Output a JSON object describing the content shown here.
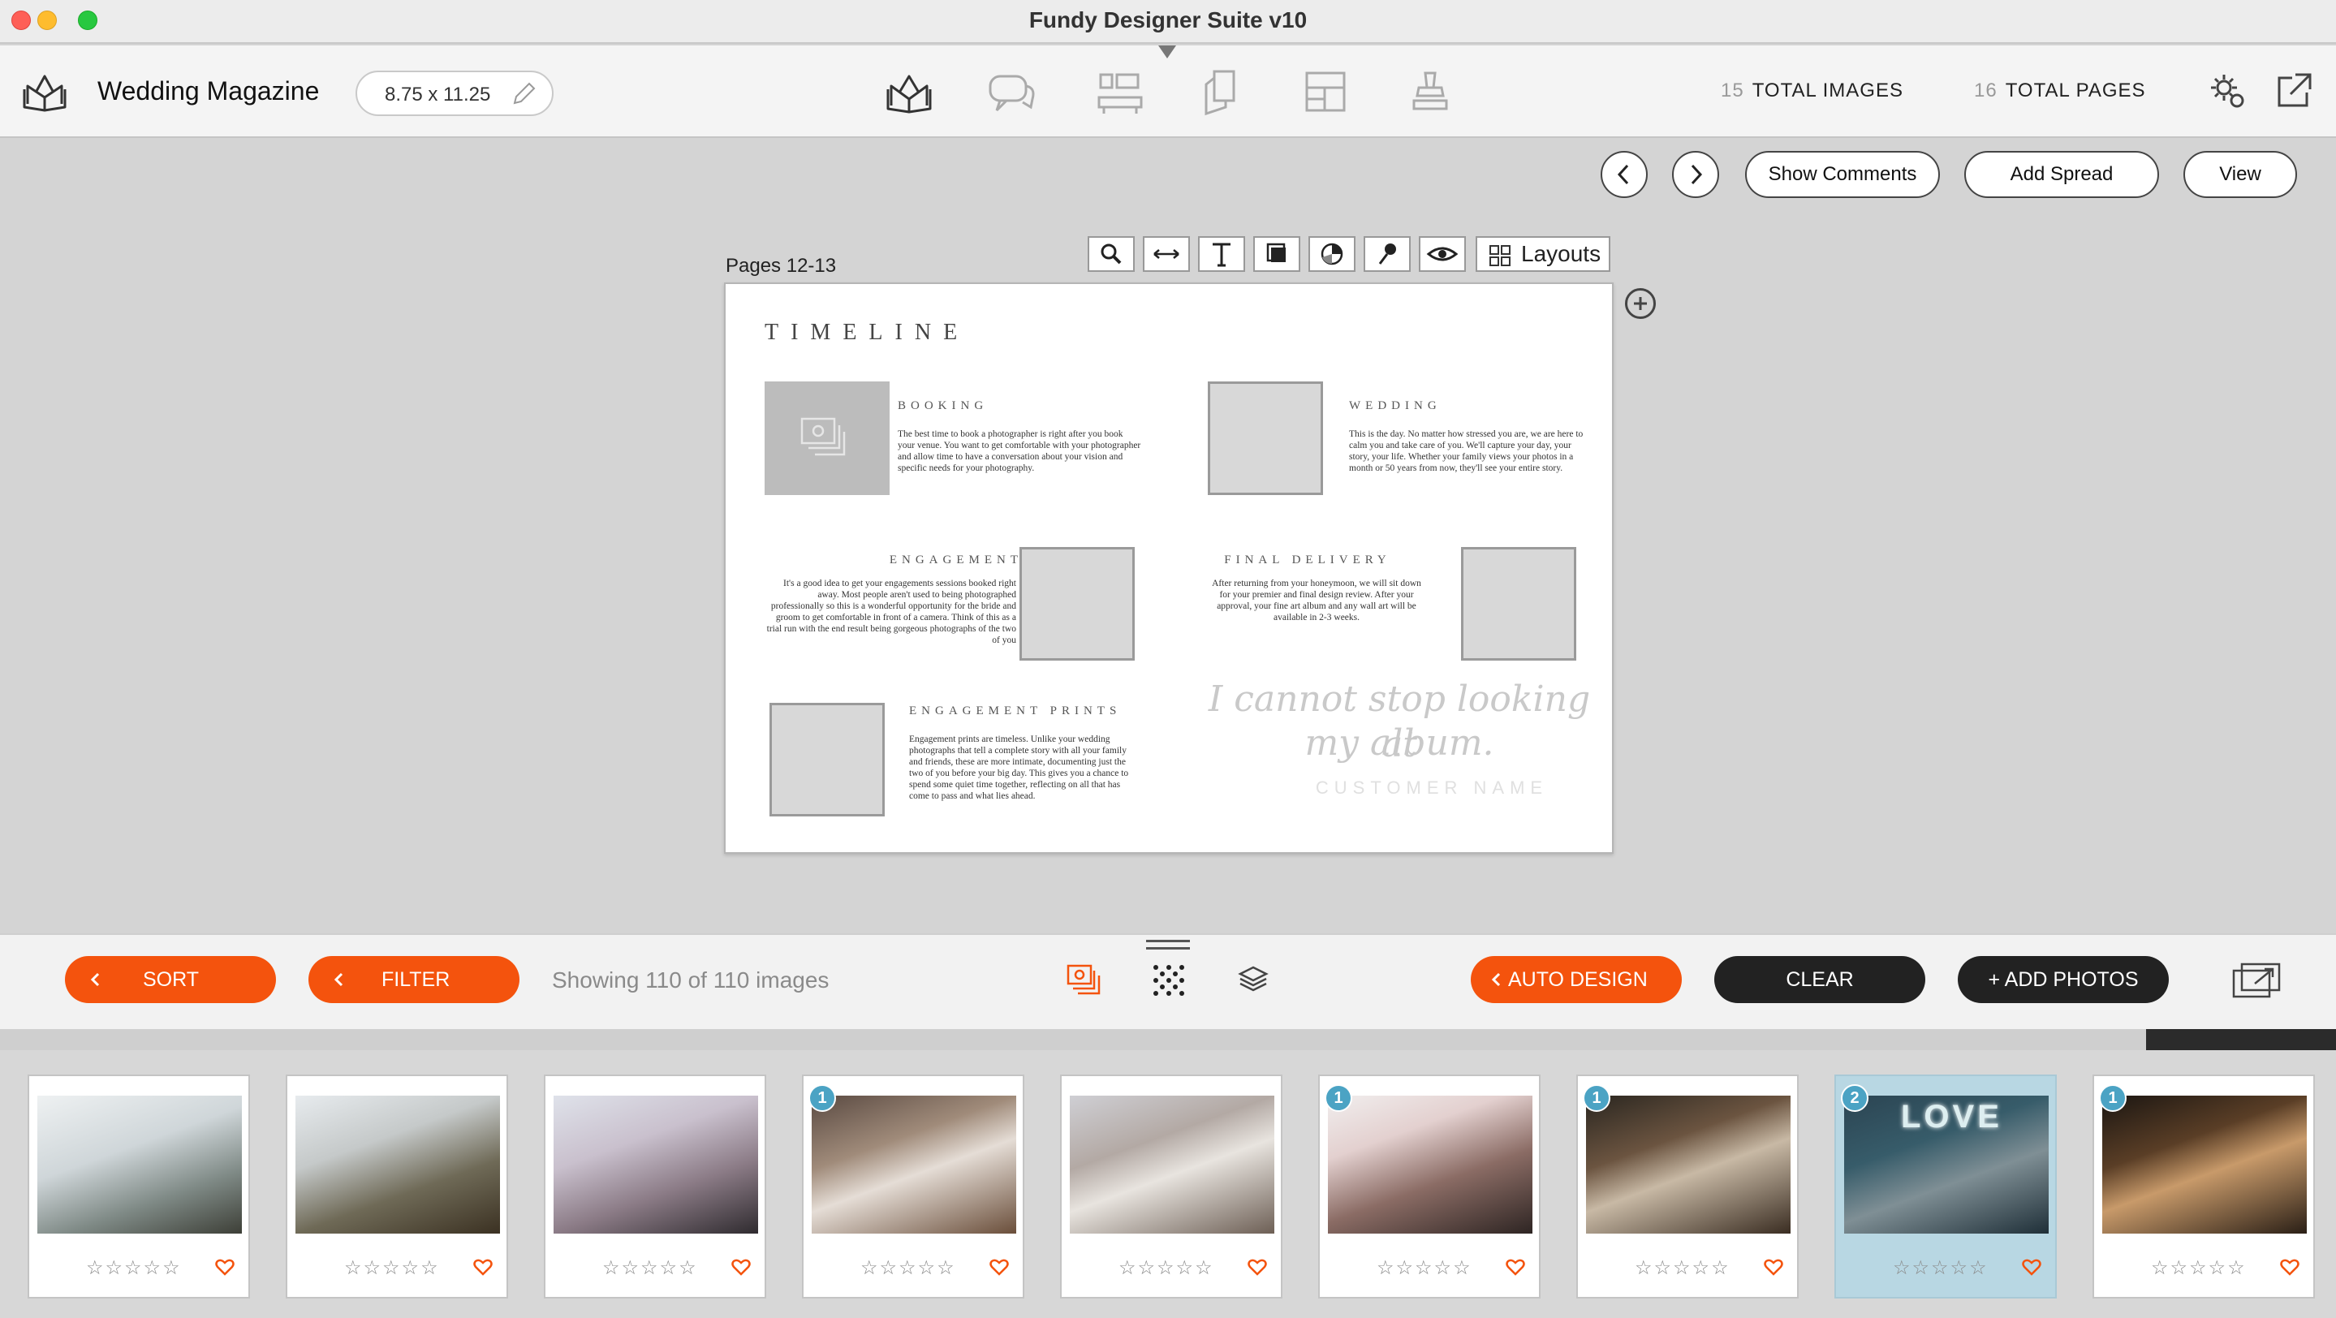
{
  "window": {
    "title": "Fundy Designer Suite v10"
  },
  "toolbar": {
    "doc_name": "Wedding Magazine",
    "page_size": "8.75 x 11.25",
    "total_images_count": "15",
    "total_images_label": "TOTAL IMAGES",
    "total_pages_count": "16",
    "total_pages_label": "TOTAL PAGES",
    "mode_icons": [
      "album-builder-icon",
      "proofing-chat-icon",
      "wall-art-icon",
      "cards-icon",
      "layouts-grid-icon",
      "sales-stamp-icon"
    ]
  },
  "nav": {
    "show_comments": "Show Comments",
    "add_spread": "Add Spread",
    "view": "View"
  },
  "spread_toolbar": {
    "pages_label": "Pages 12-13",
    "layouts": "Layouts",
    "tools": [
      "zoom-icon",
      "fit-width-icon",
      "text-tool-icon",
      "shape-tool-icon",
      "color-picker-icon",
      "pin-tool-icon",
      "preview-eye-icon"
    ]
  },
  "spread": {
    "title": "TIMELINE",
    "sections": {
      "booking": {
        "heading": "BOOKING",
        "body": "The best time to book a photographer is right after you book your venue. You want to get comfortable with your photographer and allow time to have a conversation about your vision and specific needs for your photography."
      },
      "wedding": {
        "heading": "WEDDING",
        "body": "This is the day. No matter how stressed you are, we are here to calm you and take care of you. We'll capture your day, your story, your life. Whether your family views your photos in a month or 50 years from now, they'll see your entire story."
      },
      "engagement": {
        "heading": "ENGAGEMENT",
        "body": "It's a good idea to get your engagements sessions booked right away. Most people aren't used to being photographed professionally so this is a wonderful opportunity for the bride and groom to get comfortable in front of a camera. Think of this as a trial run with the end result being gorgeous photographs of the two of you"
      },
      "final_delivery": {
        "heading": "FINAL DELIVERY",
        "body": "After returning from your honeymoon, we will sit down for your premier and final design review. After your approval, your fine art album and any wall art will be available in 2-3 weeks."
      },
      "engagement_prints": {
        "heading": "ENGAGEMENT PRINTS",
        "body": "Engagement prints are timeless. Unlike your wedding photographs that tell a complete story with all your family and friends, these are more intimate, documenting just the two of you before your big day. This gives you a chance to spend some quiet time together, reflecting on all that has come to pass and what lies ahead."
      }
    },
    "quote_line1": "I cannot stop looking at",
    "quote_line2": "my album.",
    "customer_name": "CUSTOMER NAME"
  },
  "bottom": {
    "sort": "SORT",
    "filter": "FILTER",
    "showing": "Showing 110 of 110 images",
    "auto_design": "AUTO DESIGN",
    "clear": "CLEAR",
    "add_photos": "+ ADD PHOTOS"
  },
  "filmstrip": {
    "stars": "☆☆☆☆☆",
    "thumbnails": [
      {
        "badge": "",
        "selected": false
      },
      {
        "badge": "",
        "selected": false
      },
      {
        "badge": "",
        "selected": false
      },
      {
        "badge": "1",
        "selected": false
      },
      {
        "badge": "",
        "selected": false
      },
      {
        "badge": "1",
        "selected": false
      },
      {
        "badge": "1",
        "selected": false
      },
      {
        "badge": "2",
        "selected": true,
        "overlay_text": "LOVE"
      },
      {
        "badge": "1",
        "selected": false
      }
    ]
  },
  "colors": {
    "accent_orange": "#f4530d",
    "badge_blue": "#4ba3c4",
    "selected_bg": "#b8d7e3",
    "dark_button": "#222222"
  }
}
